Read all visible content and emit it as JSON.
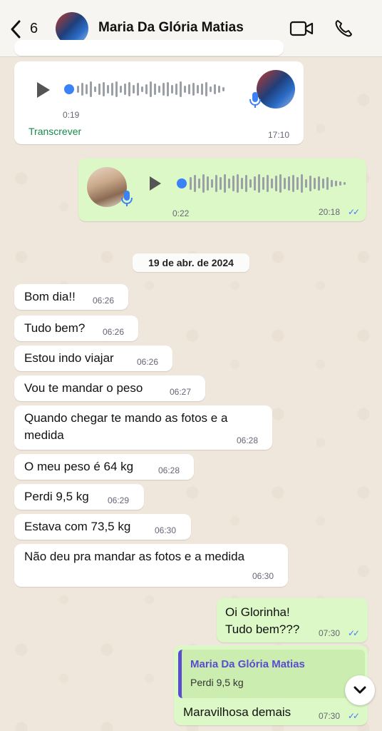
{
  "header": {
    "back_count": "6",
    "contact_name": "Maria Da Glória Matias"
  },
  "audio_in": {
    "duration": "0:19",
    "transcribe_label": "Transcrever",
    "time": "17:10"
  },
  "audio_out": {
    "duration": "0:22",
    "time": "20:18"
  },
  "date_separator": "19 de abr. de 2024",
  "incoming": [
    {
      "text": "Bom dia!!",
      "time": "06:26"
    },
    {
      "text": "Tudo bem?",
      "time": "06:26"
    },
    {
      "text": "Estou indo viajar",
      "time": "06:26"
    },
    {
      "text": "Vou te mandar o peso",
      "time": "06:27"
    },
    {
      "line1": "Quando chegar te mando as fotos e a",
      "line2": "medida",
      "time": "06:28"
    },
    {
      "text": "O meu peso é 64 kg",
      "time": "06:28"
    },
    {
      "text": "Perdi 9,5 kg",
      "time": "06:29"
    },
    {
      "text": "Estava com 73,5 kg",
      "time": "06:30"
    },
    {
      "text": "Não deu pra mandar as fotos e a medida",
      "time": "06:30"
    }
  ],
  "outgoing": [
    {
      "line1": "Oi Glorinha!",
      "line2": "Tudo bem???",
      "time": "07:30"
    },
    {
      "quote_name": "Maria Da Glória Matias",
      "quote_text": "Perdi 9,5 kg",
      "text": "Maravilhosa demais",
      "time": "07:30"
    }
  ],
  "colors": {
    "incoming_bg": "#ffffff",
    "outgoing_bg": "#dcf8c6",
    "read_ticks": "#3b82f6",
    "quote_accent": "#5a4bd1"
  },
  "icons": [
    "back-chevron-icon",
    "video-call-icon",
    "phone-icon",
    "play-icon",
    "microphone-icon",
    "double-check-icon",
    "chevron-down-icon"
  ]
}
